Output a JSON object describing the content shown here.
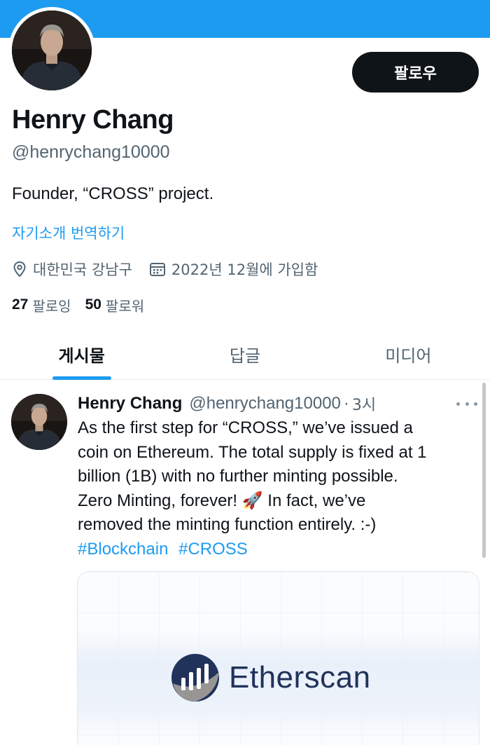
{
  "profile": {
    "name": "Henry Chang",
    "handle": "@henrychang10000",
    "bio": "Founder, “CROSS” project.",
    "translate_bio": "자기소개 번역하기",
    "location": "대한민국 강남구",
    "joined": "2022년 12월에 가입함",
    "following_count": "27",
    "following_label": "팔로잉",
    "followers_count": "50",
    "followers_label": "팔로워",
    "follow_button": "팔로우"
  },
  "tabs": [
    {
      "label": "게시물",
      "active": true
    },
    {
      "label": "답글",
      "active": false
    },
    {
      "label": "미디어",
      "active": false
    }
  ],
  "tweet": {
    "name": "Henry Chang",
    "handle": "@henrychang10000",
    "separator": "·",
    "time": "3시",
    "lines": [
      "As the first step for “CROSS,” we’ve issued a",
      "coin on Ethereum. The total supply is fixed at 1",
      "billion (1B) with no further minting possible.",
      "Zero Minting, forever! 🚀 In fact, we’ve",
      "removed the minting function entirely. :-)"
    ],
    "hashtags": [
      "#Blockchain",
      "#CROSS"
    ],
    "card": {
      "logo_text": "Etherscan"
    }
  },
  "colors": {
    "accent": "#1d9bf0",
    "text": "#0f1419",
    "secondary": "#536471",
    "button_bg": "#0f1419",
    "etherscan_navy": "#21325b"
  },
  "icons": [
    "location-pin-icon",
    "calendar-icon",
    "more-options-icon",
    "etherscan-logo-icon"
  ]
}
